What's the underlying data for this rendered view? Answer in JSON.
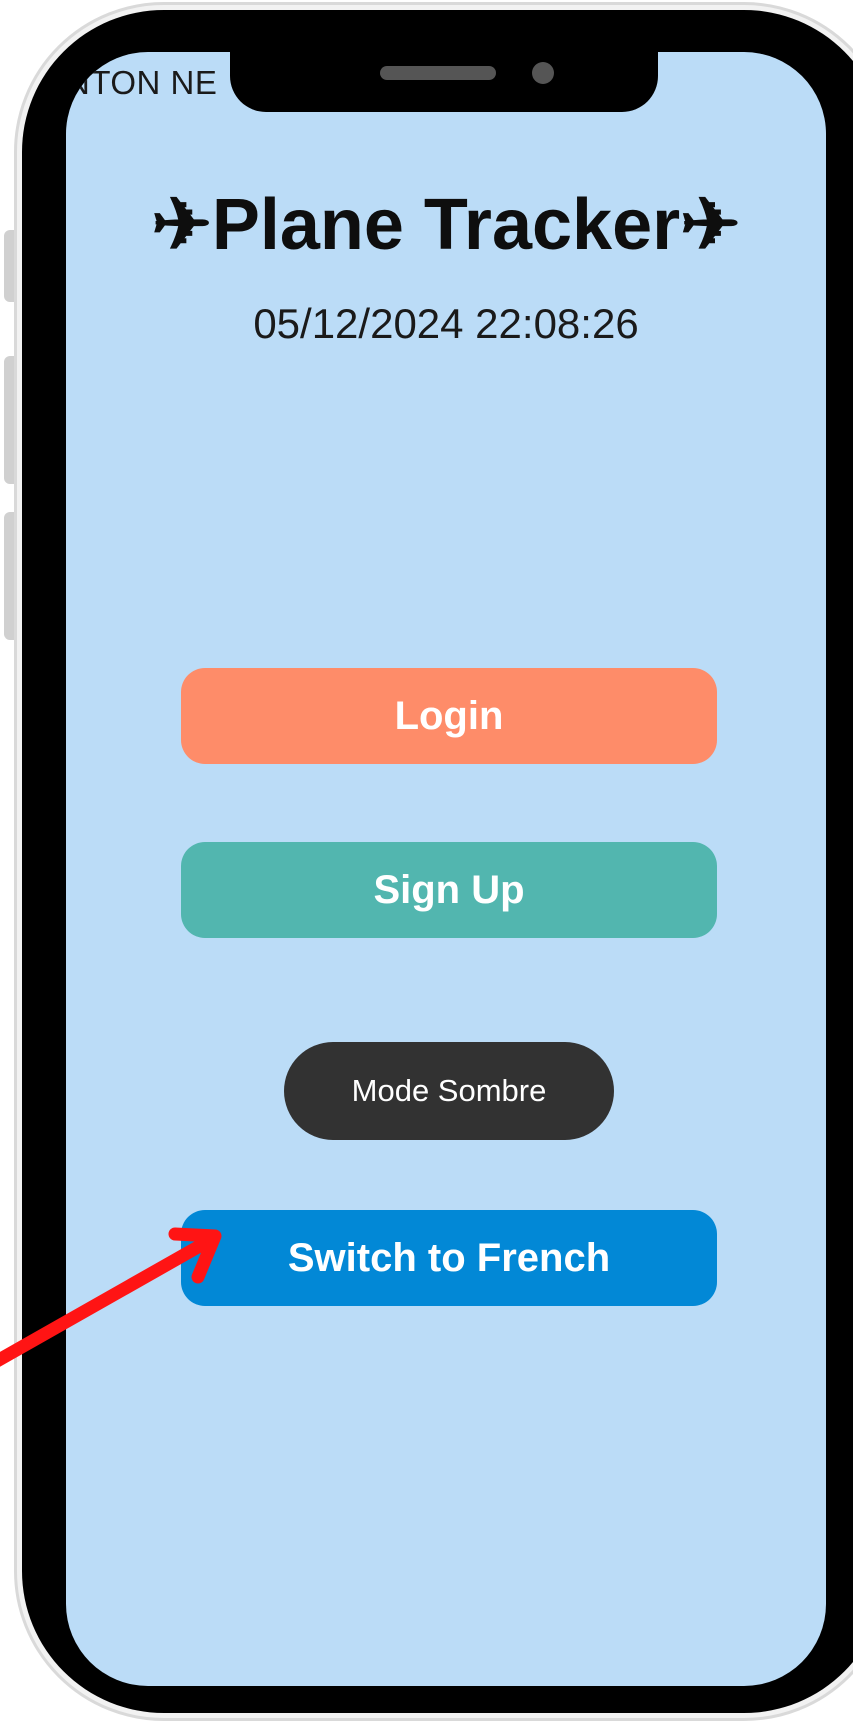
{
  "status_bar": {
    "carrier_text": "NTON NE"
  },
  "app": {
    "title": "✈Plane Tracker✈",
    "datetime": "05/12/2024 22:08:26"
  },
  "buttons": {
    "login": {
      "label": "Login",
      "color": "#fe8c69"
    },
    "signup": {
      "label": "Sign Up",
      "color": "#52b6af"
    },
    "dark_mode": {
      "label": "Mode Sombre",
      "color": "#323232"
    },
    "language": {
      "label": "Switch to French",
      "color": "#0288d6"
    }
  },
  "annotation": {
    "arrow_color": "#ff1414",
    "target": "Switch to French"
  },
  "colors": {
    "screen_background": "#bbdcf7",
    "frame": "#000000"
  }
}
